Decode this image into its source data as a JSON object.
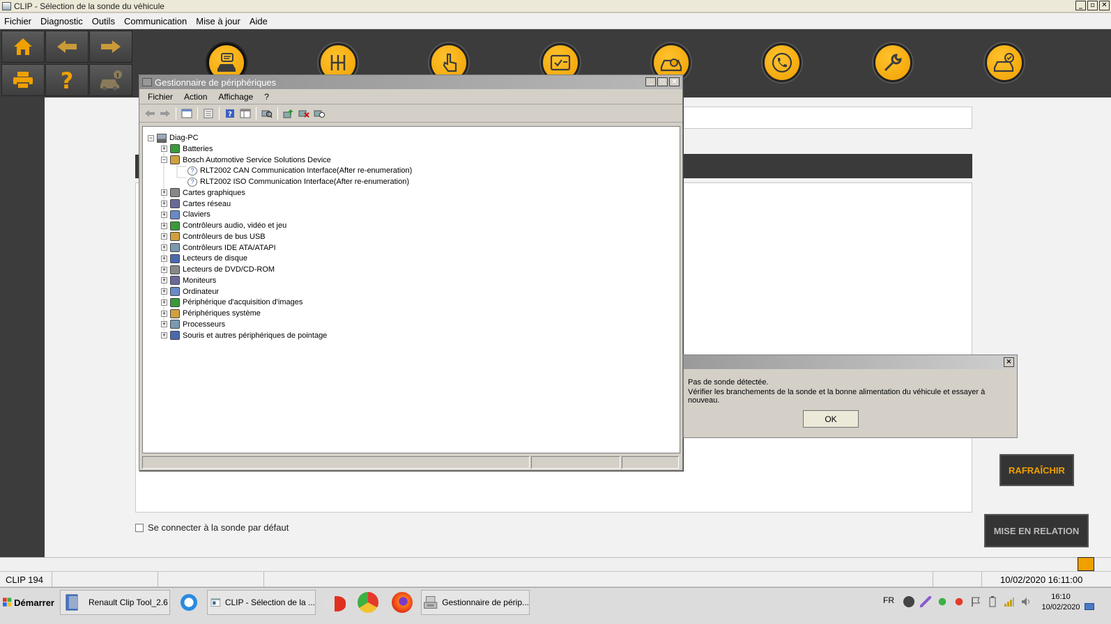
{
  "clip_window": {
    "title": "CLIP - Sélection de la sonde du véhicule",
    "menu": [
      "Fichier",
      "Diagnostic",
      "Outils",
      "Communication",
      "Mise à jour",
      "Aide"
    ],
    "default_probe_label": "Se connecter à la sonde par défaut",
    "refresh_button": "RAFRAÎCHIR",
    "relation_button": "MISE EN RELATION",
    "status_left": "CLIP 194",
    "status_datetime": "10/02/2020 16:11:00",
    "accent_color": "#f0a000"
  },
  "toolbar_icons": [
    "home-icon",
    "back-arrow-icon",
    "forward-arrow-icon",
    "printer-icon",
    "help-icon",
    "vehicle-info-icon"
  ],
  "nav_icons": [
    "vehicle-identification-icon",
    "gearbox-icon",
    "touch-icon",
    "checklist-icon",
    "vehicle-diagnostic-icon",
    "phone-support-icon",
    "wrench-icon",
    "vehicle-check-icon"
  ],
  "device_manager": {
    "title": "Gestionnaire de périphériques",
    "menu": [
      "Fichier",
      "Action",
      "Affichage",
      "?"
    ],
    "tree": [
      {
        "label": "Diag-PC",
        "level": 0,
        "toggle": "−"
      },
      {
        "label": "Batteries",
        "level": 1,
        "toggle": "+"
      },
      {
        "label": "Bosch Automotive Service Solutions Device",
        "level": 1,
        "toggle": "−"
      },
      {
        "label": "RLT2002 CAN Communication Interface(After re-enumeration)",
        "level": 2,
        "toggle": ""
      },
      {
        "label": "RLT2002 ISO Communication Interface(After re-enumeration)",
        "level": 2,
        "toggle": ""
      },
      {
        "label": "Cartes graphiques",
        "level": 1,
        "toggle": "+"
      },
      {
        "label": "Cartes réseau",
        "level": 1,
        "toggle": "+"
      },
      {
        "label": "Claviers",
        "level": 1,
        "toggle": "+"
      },
      {
        "label": "Contrôleurs audio, vidéo et jeu",
        "level": 1,
        "toggle": "+"
      },
      {
        "label": "Contrôleurs de bus USB",
        "level": 1,
        "toggle": "+"
      },
      {
        "label": "Contrôleurs IDE ATA/ATAPI",
        "level": 1,
        "toggle": "+"
      },
      {
        "label": "Lecteurs de disque",
        "level": 1,
        "toggle": "+"
      },
      {
        "label": "Lecteurs de DVD/CD-ROM",
        "level": 1,
        "toggle": "+"
      },
      {
        "label": "Moniteurs",
        "level": 1,
        "toggle": "+"
      },
      {
        "label": "Ordinateur",
        "level": 1,
        "toggle": "+"
      },
      {
        "label": "Périphérique d'acquisition d'images",
        "level": 1,
        "toggle": "+"
      },
      {
        "label": "Périphériques système",
        "level": 1,
        "toggle": "+"
      },
      {
        "label": "Processeurs",
        "level": 1,
        "toggle": "+"
      },
      {
        "label": "Souris et autres périphériques de pointage",
        "level": 1,
        "toggle": "+"
      }
    ]
  },
  "message_box": {
    "line1": "Pas de sonde détectée.",
    "line2": "Vérifier les branchements de la sonde et la bonne alimentation du véhicule et essayer à nouveau.",
    "ok_label": "OK",
    "close_label": "×"
  },
  "taskbar": {
    "start_label": "Démarrer",
    "tasks": [
      "Renault Clip Tool_2.6",
      "CLIP - Sélection de la ...",
      "Gestionnaire de périp..."
    ],
    "language": "FR",
    "clock_time": "16:10",
    "clock_date": "10/02/2020"
  }
}
